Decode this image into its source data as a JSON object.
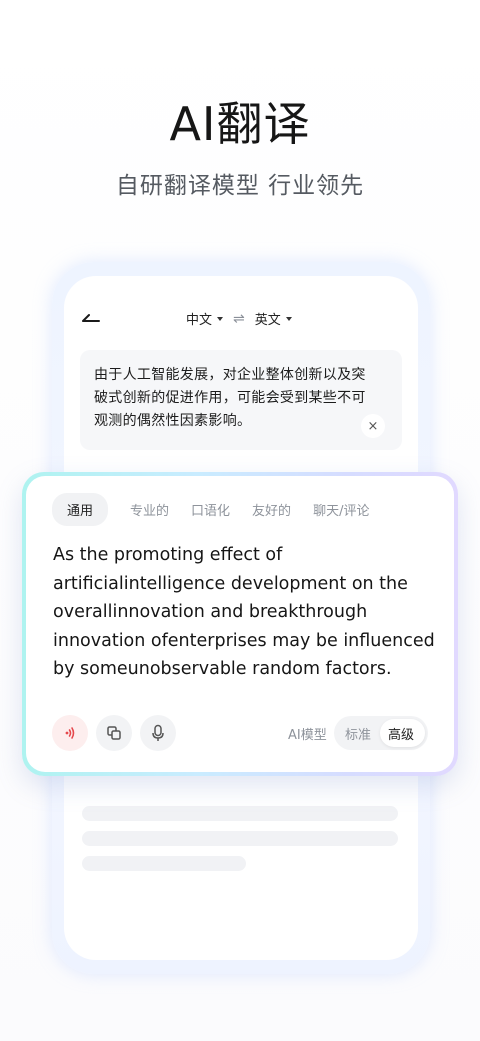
{
  "header": {
    "title": "AI翻译",
    "subtitle": "自研翻译模型 行业领先"
  },
  "phone": {
    "source_lang": "中文",
    "target_lang": "英文",
    "source_text_lines": [
      "由于人工智能发展，对企业整体创新以及突",
      "破式创新的促进作用，可能会受到某些不可",
      "观测的偶然性因素影响。"
    ],
    "clear_glyph": "×"
  },
  "card": {
    "tabs": [
      "通用",
      "专业的",
      "口语化",
      "友好的",
      "聊天/评论"
    ],
    "active_tab_index": 0,
    "translation_lines": [
      "As the promoting effect of",
      "artificialintelligence development on the",
      "overallinnovation and breakthrough",
      "innovation ofenterprises may be influenced",
      "by someunobservable random factors."
    ],
    "model_label": "AI模型",
    "model_options": [
      "标准",
      "高级"
    ],
    "selected_model": "高级",
    "icons": [
      "speaker-icon",
      "copy-icon",
      "microphone-icon"
    ],
    "colors": {
      "speaker_accent": "#e5484d",
      "card_gradient_start": "#aef3f0",
      "card_gradient_end": "#e1d9ff"
    }
  }
}
